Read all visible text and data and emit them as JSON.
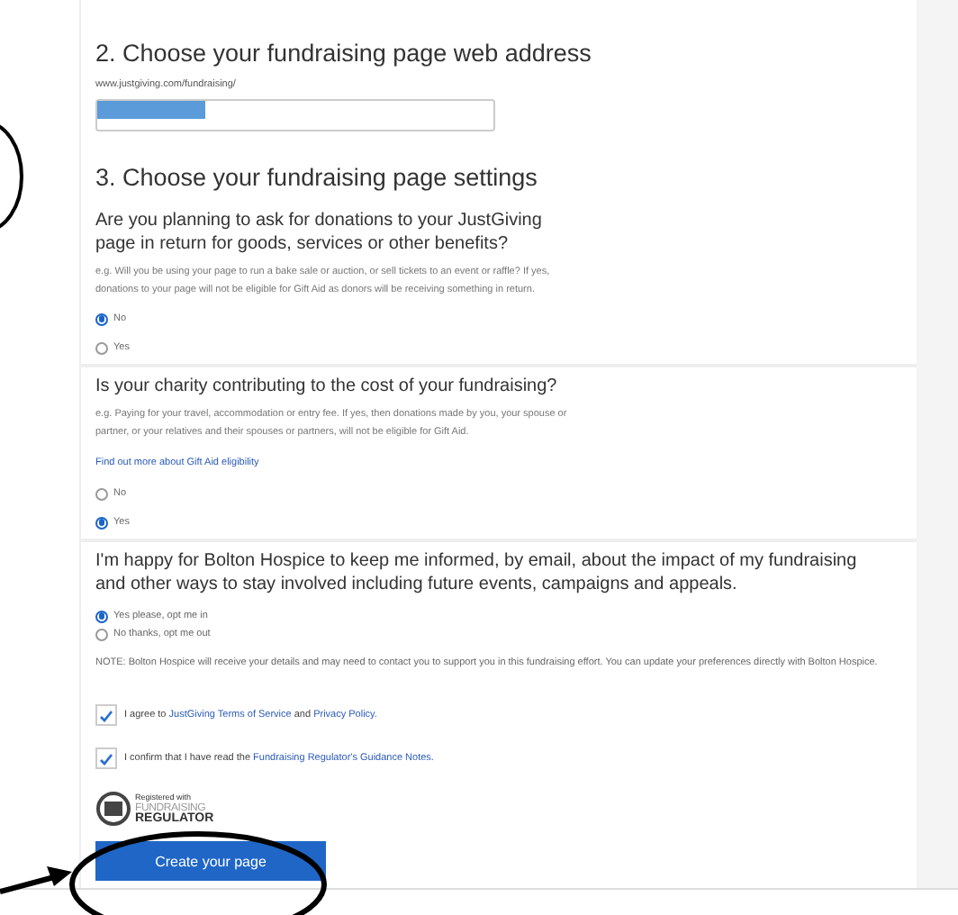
{
  "address_section": {
    "heading": "2. Choose your fundraising page web address",
    "url_prefix": "www.justgiving.com/fundraising/",
    "field": {
      "redacted": true
    }
  },
  "settings_section": {
    "heading": "3. Choose your fundraising page settings",
    "questions": [
      {
        "title": "Are you planning to ask for donations to your JustGiving page in return for goods, services or other benefits?",
        "help": "e.g. Will you be using your page to run a bake sale or auction, or sell tickets to an event or raffle? If yes, donations to your page will not be eligible for Gift Aid as donors will be receiving something in return.",
        "options": [
          {
            "label": "No",
            "selected": true
          },
          {
            "label": "Yes",
            "selected": false
          }
        ]
      },
      {
        "title": "Is your charity contributing to the cost of your fundraising?",
        "help": "e.g. Paying for your travel, accommodation or entry fee. If yes, then donations made by you, your spouse or partner, or your relatives and their spouses or partners, will not be eligible for Gift Aid.",
        "link": "Find out more about Gift Aid eligibility",
        "options": [
          {
            "label": "No",
            "selected": false
          },
          {
            "label": "Yes",
            "selected": true
          }
        ]
      },
      {
        "title": "I'm happy for Bolton Hospice to keep me informed, by email, about the impact of my fundraising and other ways to stay involved including future events, campaigns and appeals.",
        "options": [
          {
            "label": "Yes please, opt me in",
            "selected": true
          },
          {
            "label": "No thanks, opt me out",
            "selected": false
          }
        ],
        "note": "NOTE: Bolton Hospice will receive your details and may need to contact you to support you in this fundraising effort. You can update your preferences directly with Bolton Hospice."
      }
    ]
  },
  "agreements": [
    {
      "checked": true,
      "parts": [
        {
          "text": "I agree to ",
          "link": false
        },
        {
          "text": "JustGiving Terms of Service",
          "link": true
        },
        {
          "text": " and ",
          "link": false
        },
        {
          "text": "Privacy Policy.",
          "link": true
        }
      ]
    },
    {
      "checked": true,
      "parts": [
        {
          "text": "I confirm that I have read the ",
          "link": false
        },
        {
          "text": "Fundraising Regulator's Guidance Notes.",
          "link": true
        }
      ]
    }
  ],
  "regulator_logo": {
    "caption": "Registered with",
    "line_1": "FUNDRAISING",
    "line_2": "REGULATOR"
  },
  "submit_button": "Create your page"
}
